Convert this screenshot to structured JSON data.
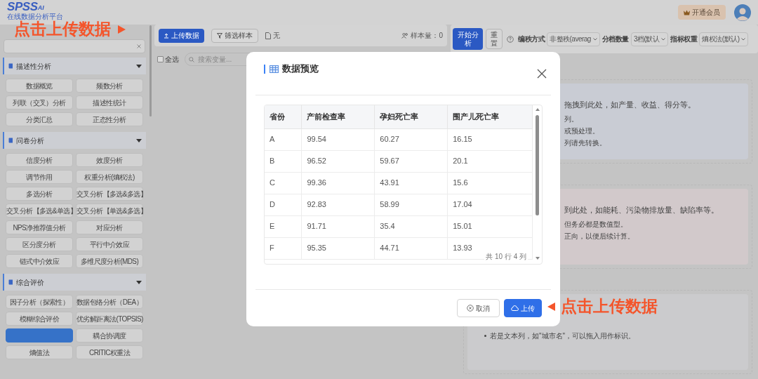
{
  "header": {
    "logo": "SPSS",
    "logo_suffix": "AI",
    "tagline": "在线数据分析平台",
    "vip_button": "开通会员"
  },
  "sidebar": {
    "sections": [
      {
        "title": "描述性分析",
        "expanded": true,
        "methods": [
          {
            "label": "数据概览",
            "selected": false
          },
          {
            "label": "频数分析",
            "selected": false
          },
          {
            "label": "列联（交叉）分析",
            "selected": false
          },
          {
            "label": "描述性统计",
            "selected": false
          },
          {
            "label": "分类汇总",
            "selected": false
          },
          {
            "label": "正态性分析",
            "selected": false
          }
        ]
      },
      {
        "title": "问卷分析",
        "expanded": true,
        "methods": [
          {
            "label": "信度分析",
            "selected": false
          },
          {
            "label": "效度分析",
            "selected": false
          },
          {
            "label": "调节作用",
            "selected": false
          },
          {
            "label": "权重分析(熵权法)",
            "selected": false
          },
          {
            "label": "多选分析",
            "selected": false
          },
          {
            "label": "交叉分析【多选&多选】",
            "selected": false
          },
          {
            "label": "交叉分析【多选&单选】",
            "selected": false
          },
          {
            "label": "交叉分析【单选&多选】",
            "selected": false
          },
          {
            "label": "NPS净推荐值分析",
            "selected": false
          },
          {
            "label": "对应分析",
            "selected": false
          },
          {
            "label": "区分度分析",
            "selected": false
          },
          {
            "label": "平行中介效应",
            "selected": false
          },
          {
            "label": "链式中介效应",
            "selected": false
          },
          {
            "label": "多维尺度分析(MDS)",
            "selected": false
          }
        ]
      },
      {
        "title": "综合评价",
        "expanded": true,
        "methods": [
          {
            "label": "因子分析（探索性）",
            "selected": false
          },
          {
            "label": "数据包络分析（DEA）",
            "selected": false
          },
          {
            "label": "模糊综合评价",
            "selected": false
          },
          {
            "label": "优劣解距离法(TOPSIS)",
            "selected": false
          },
          {
            "selected": true
          },
          {
            "label": "耦合协调度",
            "selected": false
          },
          {
            "label": "熵值法",
            "selected": false
          },
          {
            "label": "CRITIC权重法",
            "selected": false
          }
        ]
      }
    ]
  },
  "toolbar": {
    "upload_button": "上传数据",
    "filter_button": "筛选样本",
    "file_name": "无",
    "sample_size": "样本量：0"
  },
  "variables": {
    "select_all": {
      "label": "全选",
      "checked": false
    },
    "search": {
      "placeholder": "搜索变量..."
    }
  },
  "analysis_toolbar": {
    "start_button": "开始分析",
    "reset_button": "重置",
    "settings": [
      {
        "label": "编秩方式",
        "value": "非整秩(averag"
      },
      {
        "label": "分档数量",
        "value": "3档(默认"
      },
      {
        "label": "指标权重",
        "value": "熵权法(默认)"
      }
    ]
  },
  "drop_zones": [
    {
      "color": "#c9ccd4",
      "lines": [
        "拖拽到此处，如产量、收益、得分等。",
        "列。",
        "或预处理。",
        "列请先转换。"
      ]
    },
    {
      "color": "#d2c9cb",
      "lines": [
        "到此处，如能耗、污染物排放量、缺陷率等。",
        "但务必都是数值型。",
        "正向，以便后续计算。"
      ]
    },
    {
      "color": "#cbcbcd",
      "lines": [
        "若是文本列，如\"城市名\"，可以拖入用作标识。"
      ]
    }
  ],
  "modal": {
    "title": "数据预览",
    "table": {
      "columns": [
        "省份",
        "产前检查率",
        "孕妇死亡率",
        "围产儿死亡率"
      ],
      "rows": [
        [
          "A",
          "99.54",
          "60.27",
          "16.15"
        ],
        [
          "B",
          "96.52",
          "59.67",
          "20.1"
        ],
        [
          "C",
          "99.36",
          "43.91",
          "15.6"
        ],
        [
          "D",
          "92.83",
          "58.99",
          "17.04"
        ],
        [
          "E",
          "91.71",
          "35.4",
          "15.01"
        ],
        [
          "F",
          "95.35",
          "44.71",
          "13.93"
        ]
      ]
    },
    "summary": "共 10 行 4 列",
    "buttons": [
      {
        "label": "取消",
        "kind": "secondary"
      },
      {
        "label": "上传",
        "kind": "primary"
      }
    ]
  },
  "annotations": [
    {
      "text": "点击上传数据",
      "arrow_before": false
    },
    {
      "text": "点击上传数据",
      "arrow_before": true
    }
  ]
}
